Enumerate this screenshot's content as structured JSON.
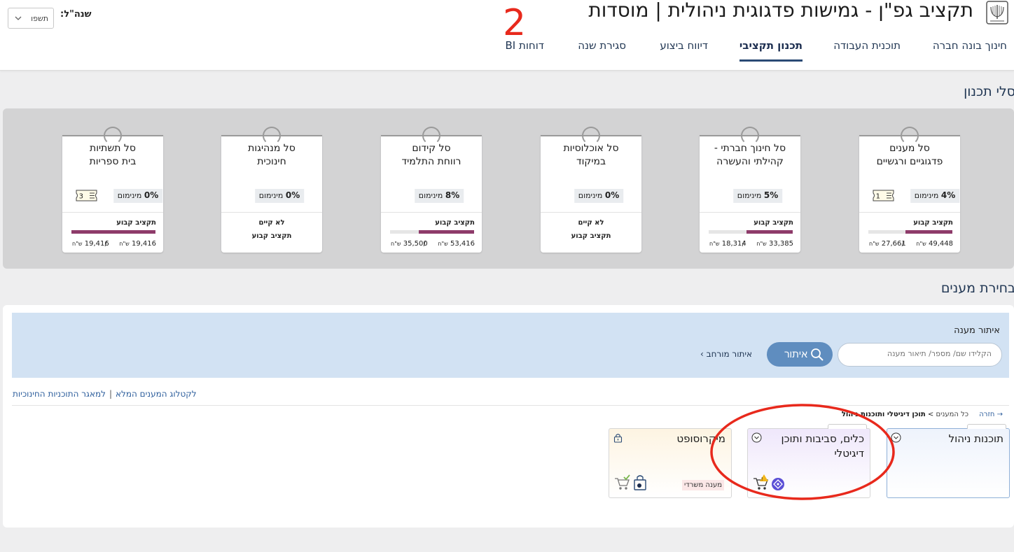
{
  "header": {
    "title": "תקציב גפ\"ן - גמישות פדגוגית ניהולית | מוסדות",
    "year_label": "שנה\"ל:",
    "year_value": "תשפו",
    "nav": [
      {
        "label": "חינוך בונה חברה"
      },
      {
        "label": "תוכנית העבודה"
      },
      {
        "label": "תכנון תקציבי"
      },
      {
        "label": "דיווח ביצוע"
      },
      {
        "label": "סגירת שנה"
      },
      {
        "label": "דוחות BI"
      }
    ],
    "annotation_number": "2"
  },
  "baskets_section": {
    "title": "סלי תכנון",
    "min_label": "מינימום",
    "fixed_label": "תקציב קבוע",
    "currency": "ש\"ח",
    "not_exists": "לא קיים",
    "cards": [
      {
        "line1": "סל מענים",
        "line2": "פדגוגיים ורגשיים",
        "pct": "4%",
        "tag": "1",
        "used": "27,661",
        "total": "49,448",
        "progress": 0.56
      },
      {
        "line1": "סל חינוך חברתי -",
        "line2": "קהילתי והעשרה",
        "pct": "5%",
        "used": "18,314",
        "total": "33,385",
        "progress": 0.55
      },
      {
        "line1": "סל אוכלוסיות",
        "line2": "במיקוד",
        "pct": "0%"
      },
      {
        "line1": "סל קידום",
        "line2": "רווחת התלמיד",
        "pct": "8%",
        "used": "35,500",
        "total": "53,416",
        "progress": 0.66
      },
      {
        "line1": "סל מנהיגות",
        "line2": "חינוכית",
        "pct": "0%"
      },
      {
        "line1": "סל תשתיות",
        "line2": "בית ספריות",
        "pct": "0%",
        "tag": "3",
        "used": "19,416",
        "total": "19,416",
        "progress": 1.0
      }
    ]
  },
  "answers_section": {
    "title": "בחירת מענים",
    "filter_title": "איתור מענה",
    "search_placeholder": "הקלידו שם/ מספר/ תיאור מענה",
    "search_button": "איתור",
    "advanced_search": "איתור מורחב",
    "link_catalog": "לקטלוג המענים המלא",
    "link_separator": "|",
    "link_programs": "למאגר התוכניות החינוכיות",
    "crumb_back": "→ חזרה",
    "crumb_all": "כל המענים",
    "crumb_arrow": ">",
    "crumb_current": "תוכן דיגיטלי ותוכנות ניהול",
    "tiles": [
      {
        "title": "תוכנות ניהול"
      },
      {
        "title": "כלים, סביבות ותוכן דיגיטלי"
      },
      {
        "title": "מיקרוסופט",
        "badge": "מענה משרדי"
      }
    ]
  },
  "colors": {
    "progress": "#8e3b6a",
    "accent_button": "#5f8dbf",
    "filter_bg": "#d2e2f3",
    "annotation": "#e8291c"
  }
}
